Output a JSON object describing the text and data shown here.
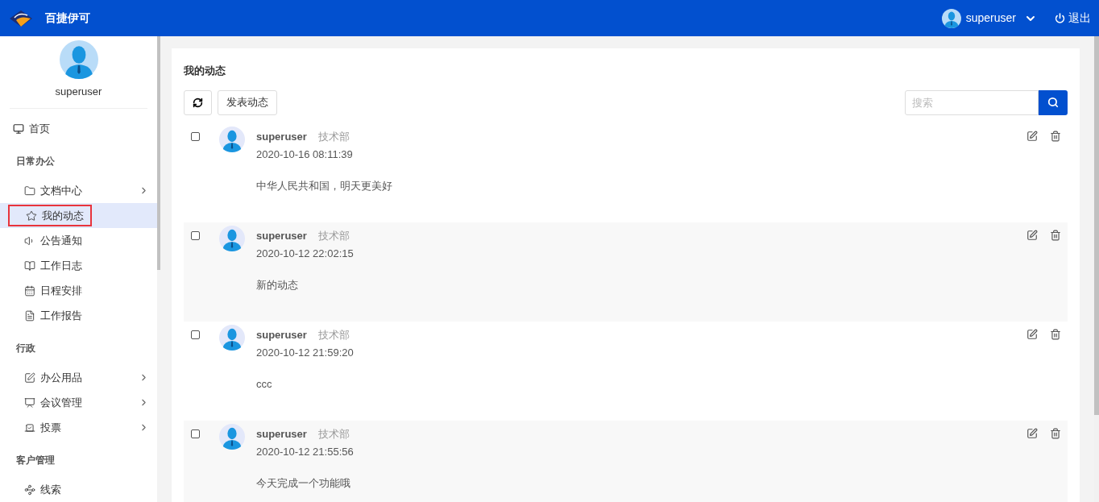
{
  "header": {
    "app_name": "百捷伊可",
    "user": "superuser",
    "logout": "退出"
  },
  "sidebar": {
    "user": "superuser",
    "items": [
      {
        "kind": "link",
        "label": "首页",
        "selected": false
      },
      {
        "kind": "group",
        "label": "日常办公",
        "children": [
          {
            "label": "文档中心",
            "selected": false,
            "expandable": true
          },
          {
            "label": "我的动态",
            "selected": true,
            "expandable": false
          },
          {
            "label": "公告通知",
            "selected": false,
            "expandable": false
          },
          {
            "label": "工作日志",
            "selected": false,
            "expandable": false
          },
          {
            "label": "日程安排",
            "selected": false,
            "expandable": false
          },
          {
            "label": "工作报告",
            "selected": false,
            "expandable": false
          }
        ]
      },
      {
        "kind": "group",
        "label": "行政",
        "children": [
          {
            "label": "办公用品",
            "selected": false,
            "expandable": true
          },
          {
            "label": "会议管理",
            "selected": false,
            "expandable": true
          },
          {
            "label": "投票",
            "selected": false,
            "expandable": true
          }
        ]
      },
      {
        "kind": "group",
        "label": "客户管理",
        "children": [
          {
            "label": "线索",
            "selected": false,
            "expandable": false
          }
        ]
      }
    ]
  },
  "main": {
    "title": "我的动态",
    "post_button": "发表动态",
    "search": {
      "placeholder": "搜索"
    },
    "posts": [
      {
        "user": "superuser",
        "dept": "技术部",
        "time": "2020-10-16 08:11:39",
        "content": "中华人民共和国，明天更美好",
        "checked": false
      },
      {
        "user": "superuser",
        "dept": "技术部",
        "time": "2020-10-12 22:02:15",
        "content": "新的动态",
        "checked": false
      },
      {
        "user": "superuser",
        "dept": "技术部",
        "time": "2020-10-12 21:59:20",
        "content": "ccc",
        "checked": false
      },
      {
        "user": "superuser",
        "dept": "技术部",
        "time": "2020-10-12 21:55:56",
        "content": "今天完成一个功能哦",
        "checked": false
      }
    ]
  }
}
